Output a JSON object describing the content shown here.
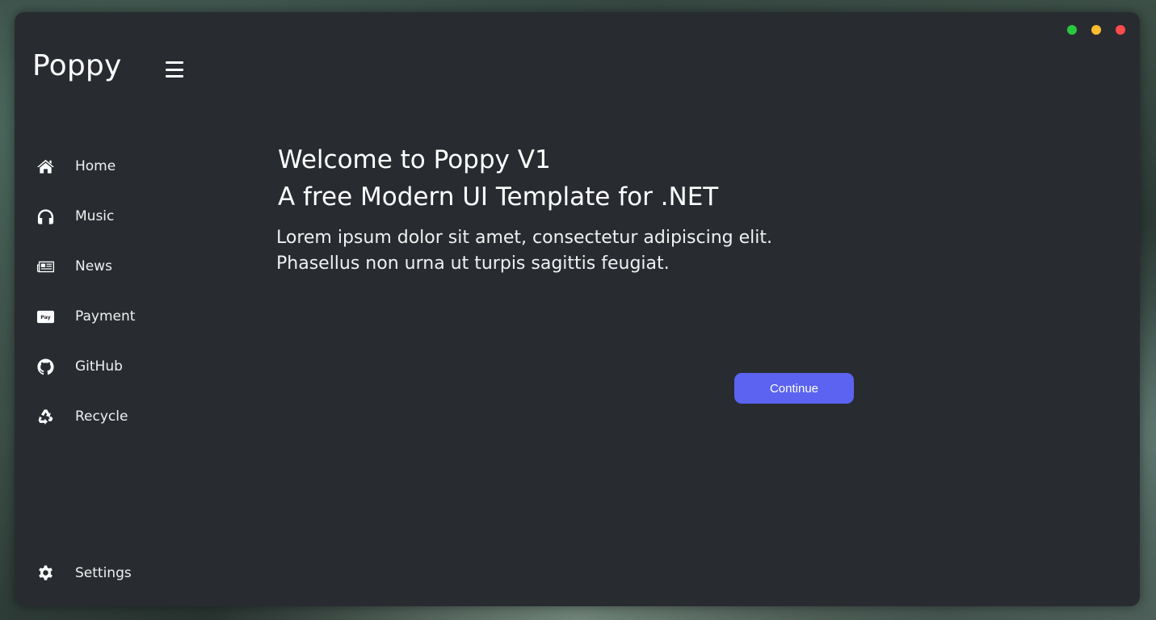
{
  "window_controls": [
    {
      "name": "maximize",
      "color": "#28c840"
    },
    {
      "name": "minimize",
      "color": "#febc2e"
    },
    {
      "name": "close",
      "color": "#ff4b4b"
    }
  ],
  "app": {
    "title": "Poppy",
    "menu_icon": "hamburger-menu-icon"
  },
  "sidebar": {
    "items": [
      {
        "label": "Home",
        "icon": "home-icon"
      },
      {
        "label": "Music",
        "icon": "headphones-icon"
      },
      {
        "label": "News",
        "icon": "newspaper-icon"
      },
      {
        "label": "Payment",
        "icon": "apple-pay-icon"
      },
      {
        "label": "GitHub",
        "icon": "github-icon"
      },
      {
        "label": "Recycle",
        "icon": "recycle-icon"
      }
    ],
    "settings": {
      "label": "Settings",
      "icon": "gear-icon"
    }
  },
  "main": {
    "heading_line1": "Welcome to Poppy V1",
    "heading_line2": "A free Modern UI Template for .NET",
    "body_line1": "Lorem ipsum dolor sit amet, consectetur adipiscing elit.",
    "body_line2": "Phasellus non urna ut turpis sagittis feugiat.",
    "continue_label": "Continue"
  },
  "colors": {
    "window_bg": "#282c31",
    "accent": "#5b63f0",
    "text": "#ffffff"
  }
}
